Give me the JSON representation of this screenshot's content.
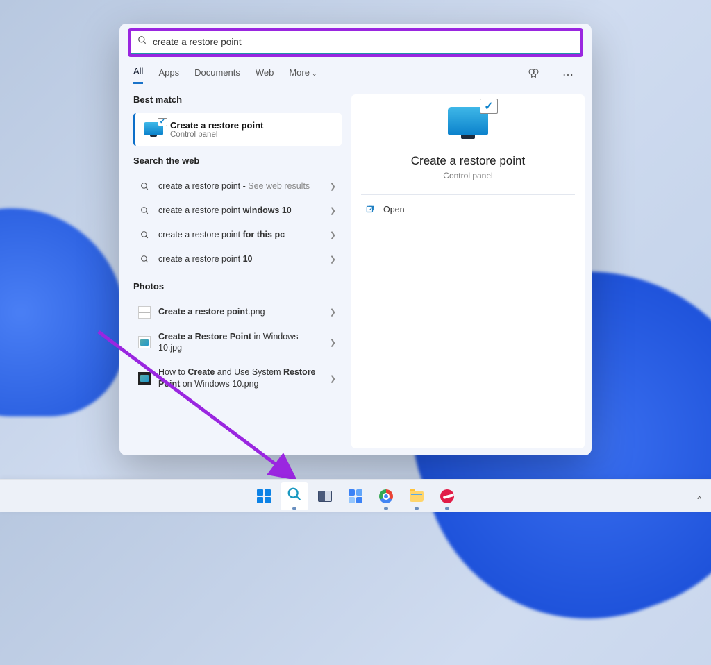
{
  "search": {
    "query": "create a restore point"
  },
  "tabs": {
    "all": "All",
    "apps": "Apps",
    "documents": "Documents",
    "web": "Web",
    "more": "More"
  },
  "sections": {
    "best_match": "Best match",
    "search_web": "Search the web",
    "photos": "Photos"
  },
  "best_match": {
    "title": "Create a restore point",
    "subtitle": "Control panel"
  },
  "web_results": [
    {
      "prefix": "create a restore point",
      "suffix": " - ",
      "muted": "See web results"
    },
    {
      "prefix": "create a restore point ",
      "bold": "windows 10"
    },
    {
      "prefix": "create a restore point ",
      "bold": "for this pc"
    },
    {
      "prefix": "create a restore point ",
      "bold": "10"
    }
  ],
  "photos": [
    {
      "html": "<b>Create a restore point</b>.png"
    },
    {
      "html": "<b>Create a Restore Point</b> in Windows 10.jpg"
    },
    {
      "html": "How to <b>Create</b> and Use System <b>Restore Point</b> on Windows 10.png"
    }
  ],
  "preview": {
    "title": "Create a restore point",
    "subtitle": "Control panel",
    "open_label": "Open"
  }
}
